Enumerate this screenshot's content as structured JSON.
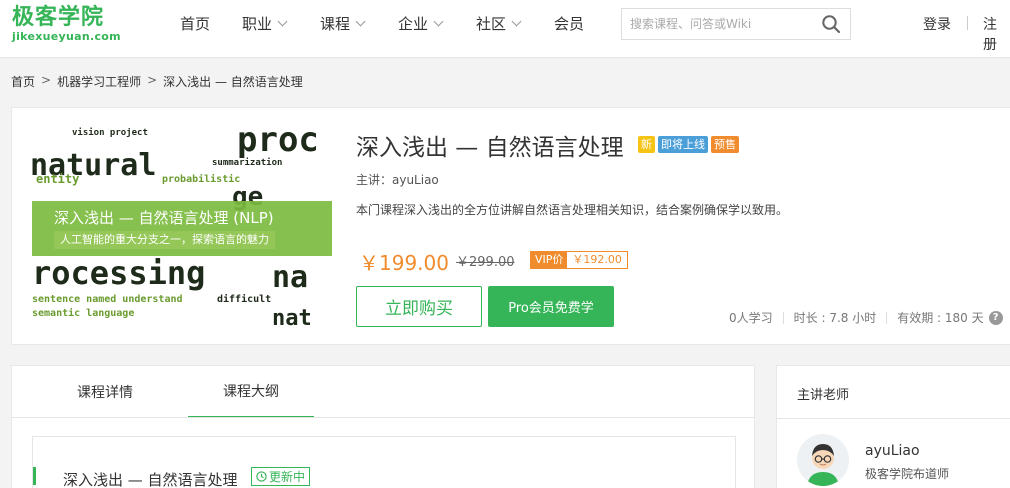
{
  "logo": {
    "cn": "极客学院",
    "en": "jikexueyuan.com"
  },
  "nav": {
    "items": [
      {
        "label": "首页",
        "dropdown": false
      },
      {
        "label": "职业",
        "dropdown": true
      },
      {
        "label": "课程",
        "dropdown": true
      },
      {
        "label": "企业",
        "dropdown": true
      },
      {
        "label": "社区",
        "dropdown": true
      },
      {
        "label": "会员",
        "dropdown": false
      }
    ],
    "search_placeholder": "搜索课程、问答或Wiki",
    "search_icon": "search-icon",
    "login": "登录",
    "register": "注册"
  },
  "breadcrumb": [
    "首页",
    "机器学习工程师",
    "深入浅出 — 自然语言处理"
  ],
  "course": {
    "cover": {
      "banner_title": "深入浅出 — 自然语言处理 (NLP)",
      "banner_subtitle": "人工智能的重大分支之一，探索语言的魅力"
    },
    "title": "深入浅出 — 自然语言处理",
    "tags": [
      "新",
      "即将上线",
      "预售"
    ],
    "lecturer": "主讲：ayuLiao",
    "description": "本门课程深入浅出的全方位讲解自然语言处理相关知识，结合案例确保学以致用。",
    "price": "￥199.00",
    "original_price": "￥299.00",
    "vip_label": "VIP价",
    "vip_price": "￥192.00",
    "buy_button": "立即购买",
    "pro_button": "Pro会员免费学",
    "stats": {
      "learners": "0人学习",
      "duration": "时长 : 7.8 小时",
      "validity": "有效期 : 180 天"
    }
  },
  "tabs": [
    {
      "label": "课程详情",
      "active": false
    },
    {
      "label": "课程大纲",
      "active": true
    }
  ],
  "outline": {
    "title": "深入浅出 — 自然语言处理",
    "badge": "更新中"
  },
  "teacher_panel": {
    "title": "主讲老师",
    "name": "ayuLiao",
    "role": "极客学院布道师"
  },
  "colors": {
    "brand_green": "#35b558",
    "price_orange": "#f08c2e",
    "tag_new": "#f6c414",
    "tag_soon": "#4b9fd9"
  }
}
